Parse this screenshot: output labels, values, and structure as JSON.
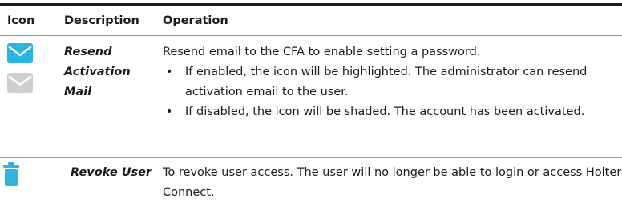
{
  "table": {
    "headers": {
      "icon": "Icon",
      "description": "Description",
      "operation": "Operation"
    },
    "rows": [
      {
        "description_line1": "Resend",
        "description_line2": "Activation Mail",
        "operation_intro": "Resend email to the CFA to enable setting a password.",
        "bullets": [
          "If enabled, the icon will be highlighted. The administrator can resend activation email to the user.",
          "If disabled, the icon will be shaded. The account has been activated."
        ],
        "icons": [
          "mail-enabled-icon",
          "mail-disabled-icon"
        ]
      },
      {
        "description": "Revoke User",
        "operation": "To revoke user access. The user will no longer be able to login or access Holter Connect.",
        "icons": [
          "trash-icon"
        ]
      }
    ]
  },
  "colors": {
    "accent": "#29b6e0",
    "disabled": "#cfcfcf",
    "rule": "#1f1f1f"
  }
}
